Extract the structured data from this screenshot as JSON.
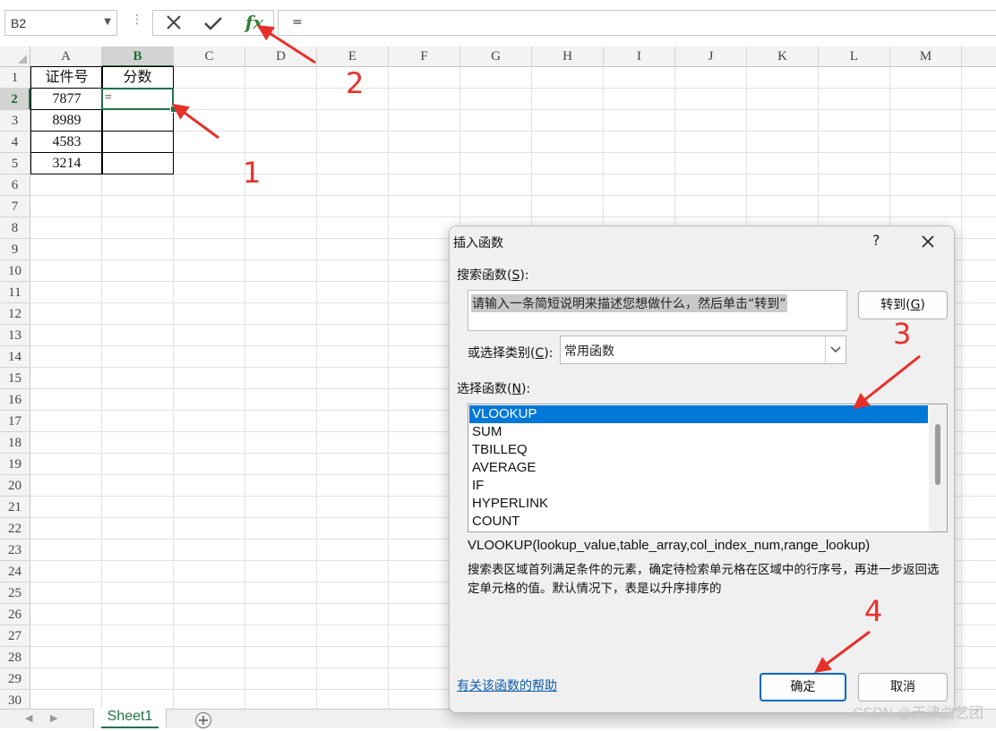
{
  "formula_bar": {
    "name_box": "B2",
    "formula": "=",
    "fx_label": "fx"
  },
  "grid": {
    "columns": [
      "A",
      "B",
      "C",
      "D",
      "E",
      "F",
      "G",
      "H",
      "I",
      "J",
      "K",
      "L",
      "M"
    ],
    "selected_column": "B",
    "rows": [
      "1",
      "2",
      "3",
      "4",
      "5",
      "6",
      "7",
      "8",
      "9",
      "10",
      "11",
      "12",
      "13",
      "14",
      "15",
      "16",
      "17",
      "18",
      "19",
      "20",
      "21",
      "22",
      "23",
      "24",
      "25",
      "26",
      "27",
      "28",
      "29",
      "30"
    ],
    "selected_row": "2",
    "table": {
      "header_a": "证件号",
      "header_b": "分数",
      "a2": "7877",
      "a3": "8989",
      "a4": "4583",
      "a5": "3214",
      "b2": "="
    }
  },
  "sheet_tabs": {
    "active": "Sheet1"
  },
  "dialog": {
    "title": "插入函数",
    "help": "?",
    "search_label_pre": "搜索函数(",
    "search_label_key": "S",
    "search_label_post": "):",
    "search_text": "请输入一条简短说明来描述您想做什么，然后单击“转到”",
    "go_pre": "转到(",
    "go_key": "G",
    "go_post": ")",
    "category_label_pre": "或选择类别(",
    "category_label_key": "C",
    "category_label_post": "):",
    "category_value": "常用函数",
    "list_label_pre": "选择函数(",
    "list_label_key": "N",
    "list_label_post": "):",
    "functions": [
      "VLOOKUP",
      "SUM",
      "TBILLEQ",
      "AVERAGE",
      "IF",
      "HYPERLINK",
      "COUNT"
    ],
    "selected_function": "VLOOKUP",
    "signature": "VLOOKUP(lookup_value,table_array,col_index_num,range_lookup)",
    "description": "搜索表区域首列满足条件的元素，确定待检索单元格在区域中的行序号，再进一步返回选定单元格的值。默认情况下，表是以升序排序的",
    "help_link": "有关该函数的帮助",
    "ok": "确定",
    "cancel": "取消"
  },
  "annotations": {
    "n1": "1",
    "n2": "2",
    "n3": "3",
    "n4": "4",
    "color": "#e8302a"
  },
  "watermark": "CSDN @天津曲艺团",
  "colors": {
    "excel_green": "#217346",
    "selection_blue": "#0078d7"
  }
}
